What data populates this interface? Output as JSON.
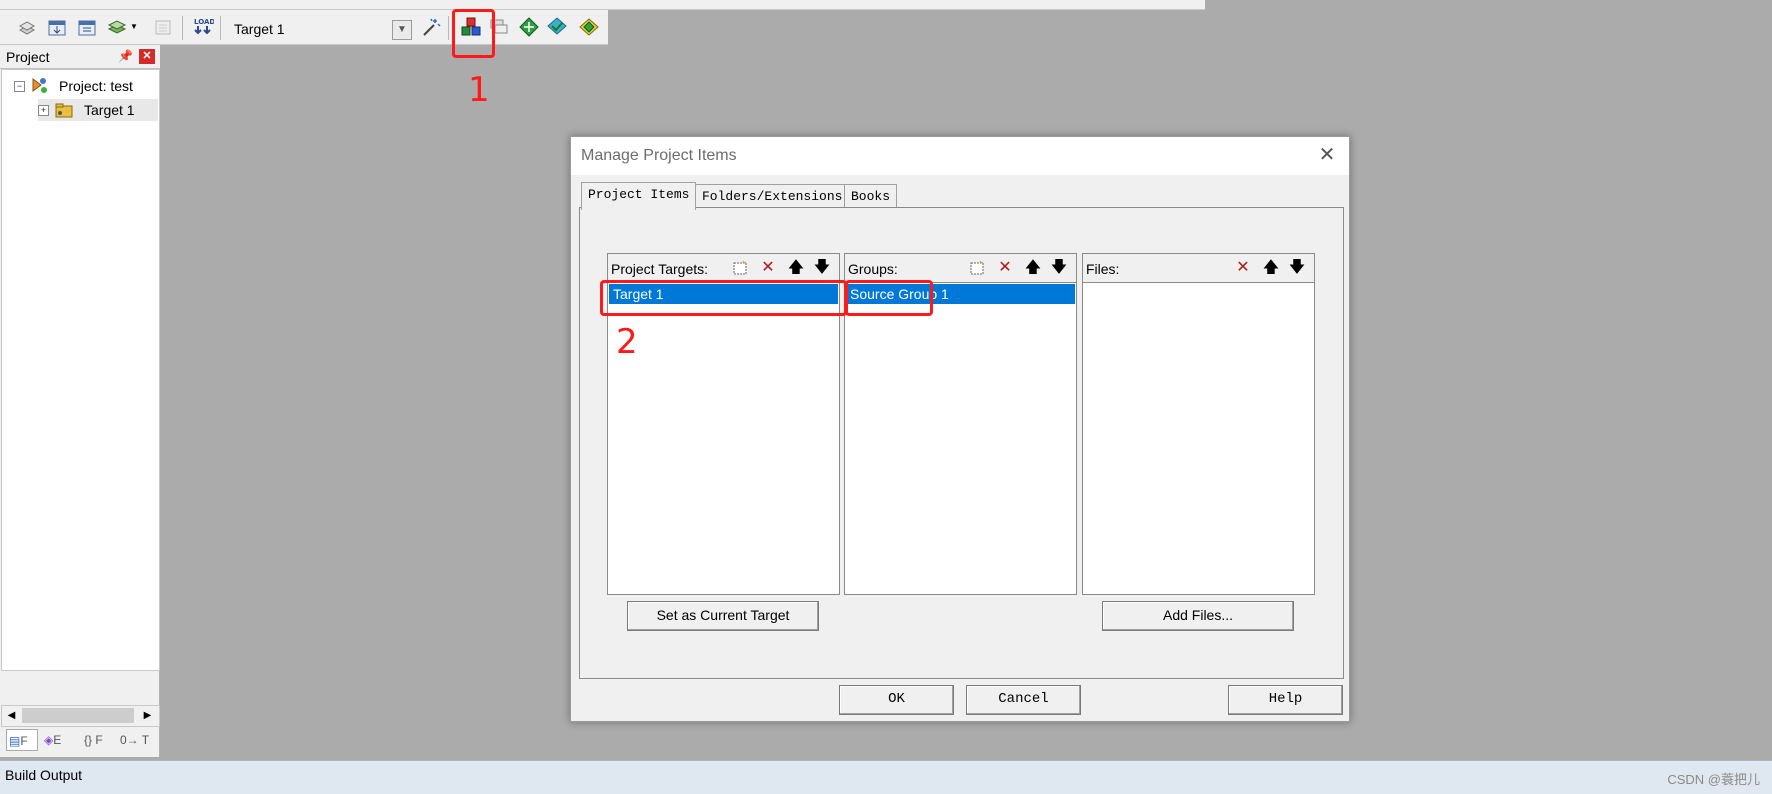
{
  "toolbar": {
    "target_name": "Target 1"
  },
  "project_panel": {
    "title": "Project",
    "project_node": "Project: test",
    "target_node": "Target 1",
    "bottom_tabs": [
      "F",
      "E",
      "{} F",
      "0→ T"
    ]
  },
  "build_output": {
    "title": "Build Output",
    "watermark": "CSDN @蓑把儿"
  },
  "dialog": {
    "title": "Manage Project Items",
    "tabs": [
      "Project Items",
      "Folders/Extensions",
      "Books"
    ],
    "targets_label": "Project Targets:",
    "groups_label": "Groups:",
    "files_label": "Files:",
    "targets": [
      "Target 1"
    ],
    "groups": [
      "Source Group 1"
    ],
    "set_current_target": "Set as Current Target",
    "add_files": "Add Files...",
    "ok": "OK",
    "cancel": "Cancel",
    "help": "Help"
  },
  "annotations": {
    "marker_1": "1",
    "marker_2": "2"
  },
  "colors": {
    "selection": "#0078d7",
    "annotation_red": "#ff1a1a",
    "workspace": "#ababab"
  }
}
